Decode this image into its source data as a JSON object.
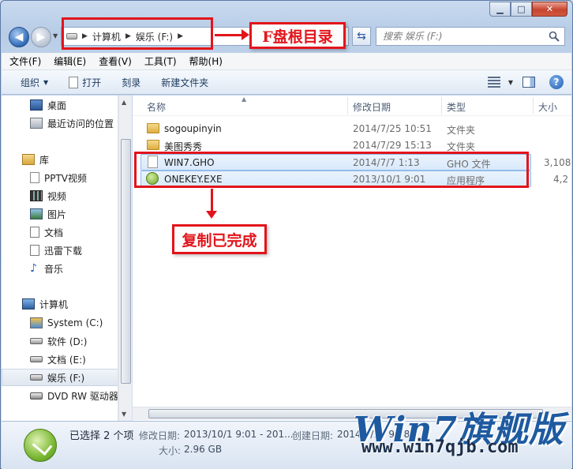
{
  "window": {
    "caption": {
      "minimize": "▁",
      "maximize": "□",
      "close": "✕"
    }
  },
  "address_bar": {
    "crumbs": [
      "计算机",
      "娱乐 (F:)"
    ]
  },
  "search": {
    "placeholder": "搜索 娱乐 (F:)"
  },
  "menu": [
    "文件(F)",
    "编辑(E)",
    "查看(V)",
    "工具(T)",
    "帮助(H)"
  ],
  "toolbar": {
    "organize": "组织",
    "open": "打开",
    "burn": "刻录",
    "new_folder": "新建文件夹"
  },
  "nav_pane": {
    "favorites": [
      "桌面",
      "最近访问的位置"
    ],
    "libraries_header": "库",
    "libraries": [
      "PPTV视频",
      "视频",
      "图片",
      "文档",
      "迅雷下载",
      "音乐"
    ],
    "computer_header": "计算机",
    "drives": [
      "System (C:)",
      "软件 (D:)",
      "文档 (E:)",
      "娱乐 (F:)",
      "DVD RW 驱动器"
    ]
  },
  "columns": {
    "name": "名称",
    "modified": "修改日期",
    "type": "类型",
    "size": "大小"
  },
  "files": [
    {
      "name": "sogoupinyin",
      "modified": "2014/7/25 10:51",
      "type": "文件夹",
      "size": "",
      "icon": "folder-icon"
    },
    {
      "name": "美图秀秀",
      "modified": "2014/7/29 15:13",
      "type": "文件夹",
      "size": "",
      "icon": "folder-icon"
    },
    {
      "name": "WIN7.GHO",
      "modified": "2014/7/7 1:13",
      "type": "GHO 文件",
      "size": "3,108",
      "icon": "file-icon"
    },
    {
      "name": "ONEKEY.EXE",
      "modified": "2013/10/1 9:01",
      "type": "应用程序",
      "size": "4,2",
      "icon": "exe-icon"
    }
  ],
  "details": {
    "selected": "已选择 2 个项",
    "modified_label": "修改日期:",
    "modified_value": "2013/10/1 9:01 - 201...",
    "created_label": "创建日期:",
    "created_value": "2014/8/11 9:08",
    "size_label": "大小:",
    "size_value": "2.96 GB"
  },
  "annotations": {
    "root_label": "F盘根目录",
    "done_label": "复制已完成"
  },
  "watermark": {
    "logo_text": "Win7旗舰版",
    "url": "www.win7qjb.com"
  },
  "colors": {
    "annotation_red": "#e3141b",
    "accent_blue": "#1e5aa0"
  }
}
